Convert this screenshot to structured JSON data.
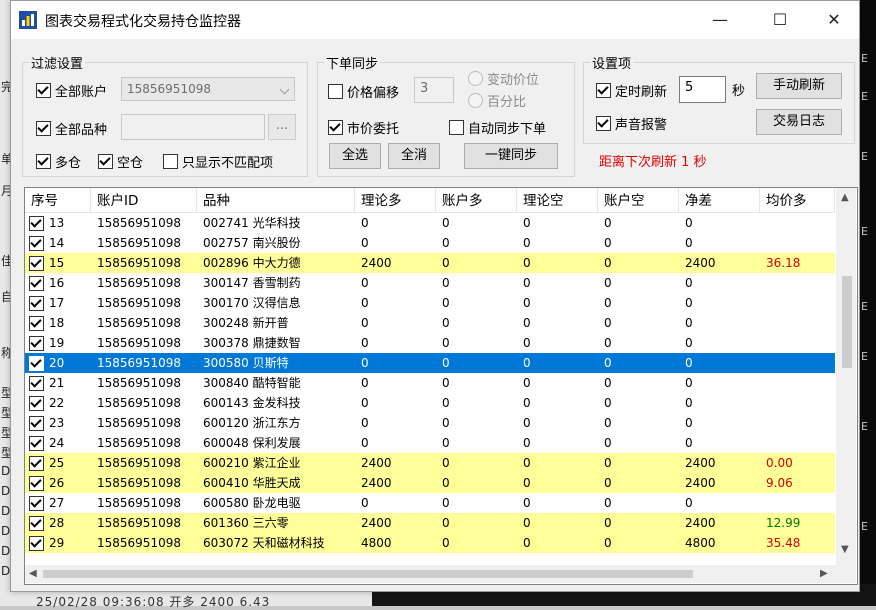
{
  "window": {
    "title": "图表交易程式化交易持仓监控器",
    "accent": "#0078d7"
  },
  "titlebar_buttons": {
    "minimize": "—",
    "maximize": "☐",
    "close": "✕"
  },
  "filter": {
    "label": "过滤设置",
    "all_accounts": {
      "label": "全部账户",
      "checked": true
    },
    "account_value": "15856951098",
    "all_symbols": {
      "label": "全部品种",
      "checked": true
    },
    "symbol_value": "",
    "browse_label": "...",
    "long": {
      "label": "多仓",
      "checked": true
    },
    "short": {
      "label": "空仓",
      "checked": true
    },
    "mismatch_only": {
      "label": "只显示不匹配项",
      "checked": false
    }
  },
  "order_sync": {
    "label": "下单同步",
    "price_offset": {
      "label": "价格偏移",
      "checked": false
    },
    "offset_value": "3",
    "radio_change": "变动价位",
    "radio_percent": "百分比",
    "market_order": {
      "label": "市价委托",
      "checked": true
    },
    "auto_sync": {
      "label": "自动同步下单",
      "checked": false
    },
    "select_all": "全选",
    "deselect_all": "全消",
    "one_click_sync": "一键同步"
  },
  "settings": {
    "label": "设置项",
    "timed_refresh": {
      "label": "定时刷新",
      "checked": true
    },
    "refresh_seconds": "5",
    "seconds_unit": "秒",
    "manual_refresh": "手动刷新",
    "sound_alert": {
      "label": "声音报警",
      "checked": true
    },
    "trade_log": "交易日志",
    "countdown": "距离下次刷新 1 秒"
  },
  "table": {
    "columns": [
      "序号",
      "账户ID",
      "品种",
      "理论多",
      "账户多",
      "理论空",
      "账户空",
      "净差",
      "均价多"
    ],
    "rows": [
      {
        "no": "13",
        "account": "15856951098",
        "symbol": "002741 光华科技",
        "tl": "0",
        "al": "0",
        "ts": "0",
        "as": "0",
        "net": "0",
        "avg": "",
        "state": "normal",
        "avg_color": ""
      },
      {
        "no": "14",
        "account": "15856951098",
        "symbol": "002757 南兴股份",
        "tl": "0",
        "al": "0",
        "ts": "0",
        "as": "0",
        "net": "0",
        "avg": "",
        "state": "normal",
        "avg_color": ""
      },
      {
        "no": "15",
        "account": "15856951098",
        "symbol": "002896 中大力德",
        "tl": "2400",
        "al": "0",
        "ts": "0",
        "as": "0",
        "net": "2400",
        "avg": "36.18",
        "state": "hl",
        "avg_color": "red"
      },
      {
        "no": "16",
        "account": "15856951098",
        "symbol": "300147 香雪制药",
        "tl": "0",
        "al": "0",
        "ts": "0",
        "as": "0",
        "net": "0",
        "avg": "",
        "state": "normal",
        "avg_color": ""
      },
      {
        "no": "17",
        "account": "15856951098",
        "symbol": "300170 汉得信息",
        "tl": "0",
        "al": "0",
        "ts": "0",
        "as": "0",
        "net": "0",
        "avg": "",
        "state": "normal",
        "avg_color": ""
      },
      {
        "no": "18",
        "account": "15856951098",
        "symbol": "300248 新开普",
        "tl": "0",
        "al": "0",
        "ts": "0",
        "as": "0",
        "net": "0",
        "avg": "",
        "state": "normal",
        "avg_color": ""
      },
      {
        "no": "19",
        "account": "15856951098",
        "symbol": "300378 鼎捷数智",
        "tl": "0",
        "al": "0",
        "ts": "0",
        "as": "0",
        "net": "0",
        "avg": "",
        "state": "normal",
        "avg_color": ""
      },
      {
        "no": "20",
        "account": "15856951098",
        "symbol": "300580 贝斯特",
        "tl": "0",
        "al": "0",
        "ts": "0",
        "as": "0",
        "net": "0",
        "avg": "",
        "state": "sel",
        "avg_color": ""
      },
      {
        "no": "21",
        "account": "15856951098",
        "symbol": "300840 酷特智能",
        "tl": "0",
        "al": "0",
        "ts": "0",
        "as": "0",
        "net": "0",
        "avg": "",
        "state": "normal",
        "avg_color": ""
      },
      {
        "no": "22",
        "account": "15856951098",
        "symbol": "600143 金发科技",
        "tl": "0",
        "al": "0",
        "ts": "0",
        "as": "0",
        "net": "0",
        "avg": "",
        "state": "normal",
        "avg_color": ""
      },
      {
        "no": "23",
        "account": "15856951098",
        "symbol": "600120 浙江东方",
        "tl": "0",
        "al": "0",
        "ts": "0",
        "as": "0",
        "net": "0",
        "avg": "",
        "state": "normal",
        "avg_color": ""
      },
      {
        "no": "24",
        "account": "15856951098",
        "symbol": "600048 保利发展",
        "tl": "0",
        "al": "0",
        "ts": "0",
        "as": "0",
        "net": "0",
        "avg": "",
        "state": "normal",
        "avg_color": ""
      },
      {
        "no": "25",
        "account": "15856951098",
        "symbol": "600210 紫江企业",
        "tl": "2400",
        "al": "0",
        "ts": "0",
        "as": "0",
        "net": "2400",
        "avg": "0.00",
        "state": "hl",
        "avg_color": "red"
      },
      {
        "no": "26",
        "account": "15856951098",
        "symbol": "600410 华胜天成",
        "tl": "2400",
        "al": "0",
        "ts": "0",
        "as": "0",
        "net": "2400",
        "avg": "9.06",
        "state": "hl",
        "avg_color": "red"
      },
      {
        "no": "27",
        "account": "15856951098",
        "symbol": "600580 卧龙电驱",
        "tl": "0",
        "al": "0",
        "ts": "0",
        "as": "0",
        "net": "0",
        "avg": "",
        "state": "normal",
        "avg_color": ""
      },
      {
        "no": "28",
        "account": "15856951098",
        "symbol": "601360 三六零",
        "tl": "2400",
        "al": "0",
        "ts": "0",
        "as": "0",
        "net": "2400",
        "avg": "12.99",
        "state": "hl",
        "avg_color": "green"
      },
      {
        "no": "29",
        "account": "15856951098",
        "symbol": "603072 天和磁材科技",
        "tl": "4800",
        "al": "0",
        "ts": "0",
        "as": "0",
        "net": "4800",
        "avg": "35.48",
        "state": "hl",
        "avg_color": "red"
      }
    ]
  },
  "background": {
    "left_chars": [
      "完",
      "单",
      "月",
      "佳",
      "自",
      "称",
      "型",
      "型",
      "型",
      "型",
      "D",
      "D",
      "D",
      "D",
      "D",
      "D"
    ],
    "right_chars": [
      "E",
      "E",
      "E",
      "E",
      "E",
      "E",
      "E",
      "E"
    ],
    "bottom_text": "25/02/28 09:36:08  开多  2400  6.43"
  }
}
